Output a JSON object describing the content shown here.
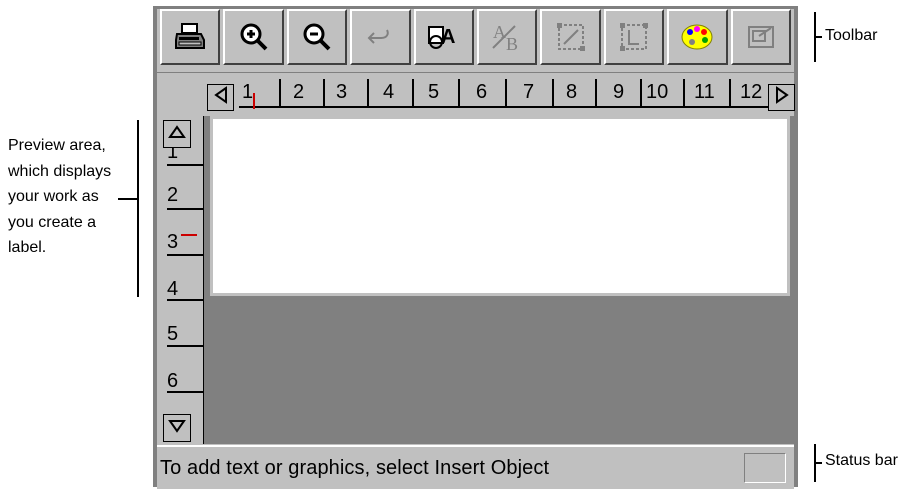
{
  "annotations": {
    "toolbar_label": "Toolbar",
    "preview_label": "Preview area, which displays your work as you create a label.",
    "status_bar_label": "Status bar"
  },
  "toolbar": {
    "buttons": [
      {
        "name": "print",
        "icon": "printer-icon",
        "enabled": true
      },
      {
        "name": "zoom-in",
        "icon": "zoom-in-icon",
        "enabled": true
      },
      {
        "name": "zoom-out",
        "icon": "zoom-out-icon",
        "enabled": true
      },
      {
        "name": "undo",
        "icon": "undo-icon",
        "enabled": false
      },
      {
        "name": "insert-object",
        "icon": "insert-object-icon",
        "enabled": true
      },
      {
        "name": "text-format",
        "icon": "text-format-icon",
        "enabled": false
      },
      {
        "name": "resize",
        "icon": "resize-icon",
        "enabled": false
      },
      {
        "name": "align",
        "icon": "align-icon",
        "enabled": false
      },
      {
        "name": "color-palette",
        "icon": "palette-icon",
        "enabled": true
      },
      {
        "name": "properties",
        "icon": "properties-icon",
        "enabled": false
      }
    ]
  },
  "horizontal_ruler": {
    "numbers": [
      "1",
      "2",
      "3",
      "4",
      "5",
      "6",
      "7",
      "8",
      "9",
      "10",
      "11",
      "12"
    ]
  },
  "vertical_ruler": {
    "numbers": [
      "1",
      "2",
      "3",
      "4",
      "5",
      "6"
    ]
  },
  "status": {
    "message": "To add text or graphics, select Insert Object"
  },
  "colors": {
    "window_face": "#c0c0c0",
    "preview_background": "#808080",
    "canvas": "#ffffff",
    "ruler_marker": "#cc0000"
  }
}
